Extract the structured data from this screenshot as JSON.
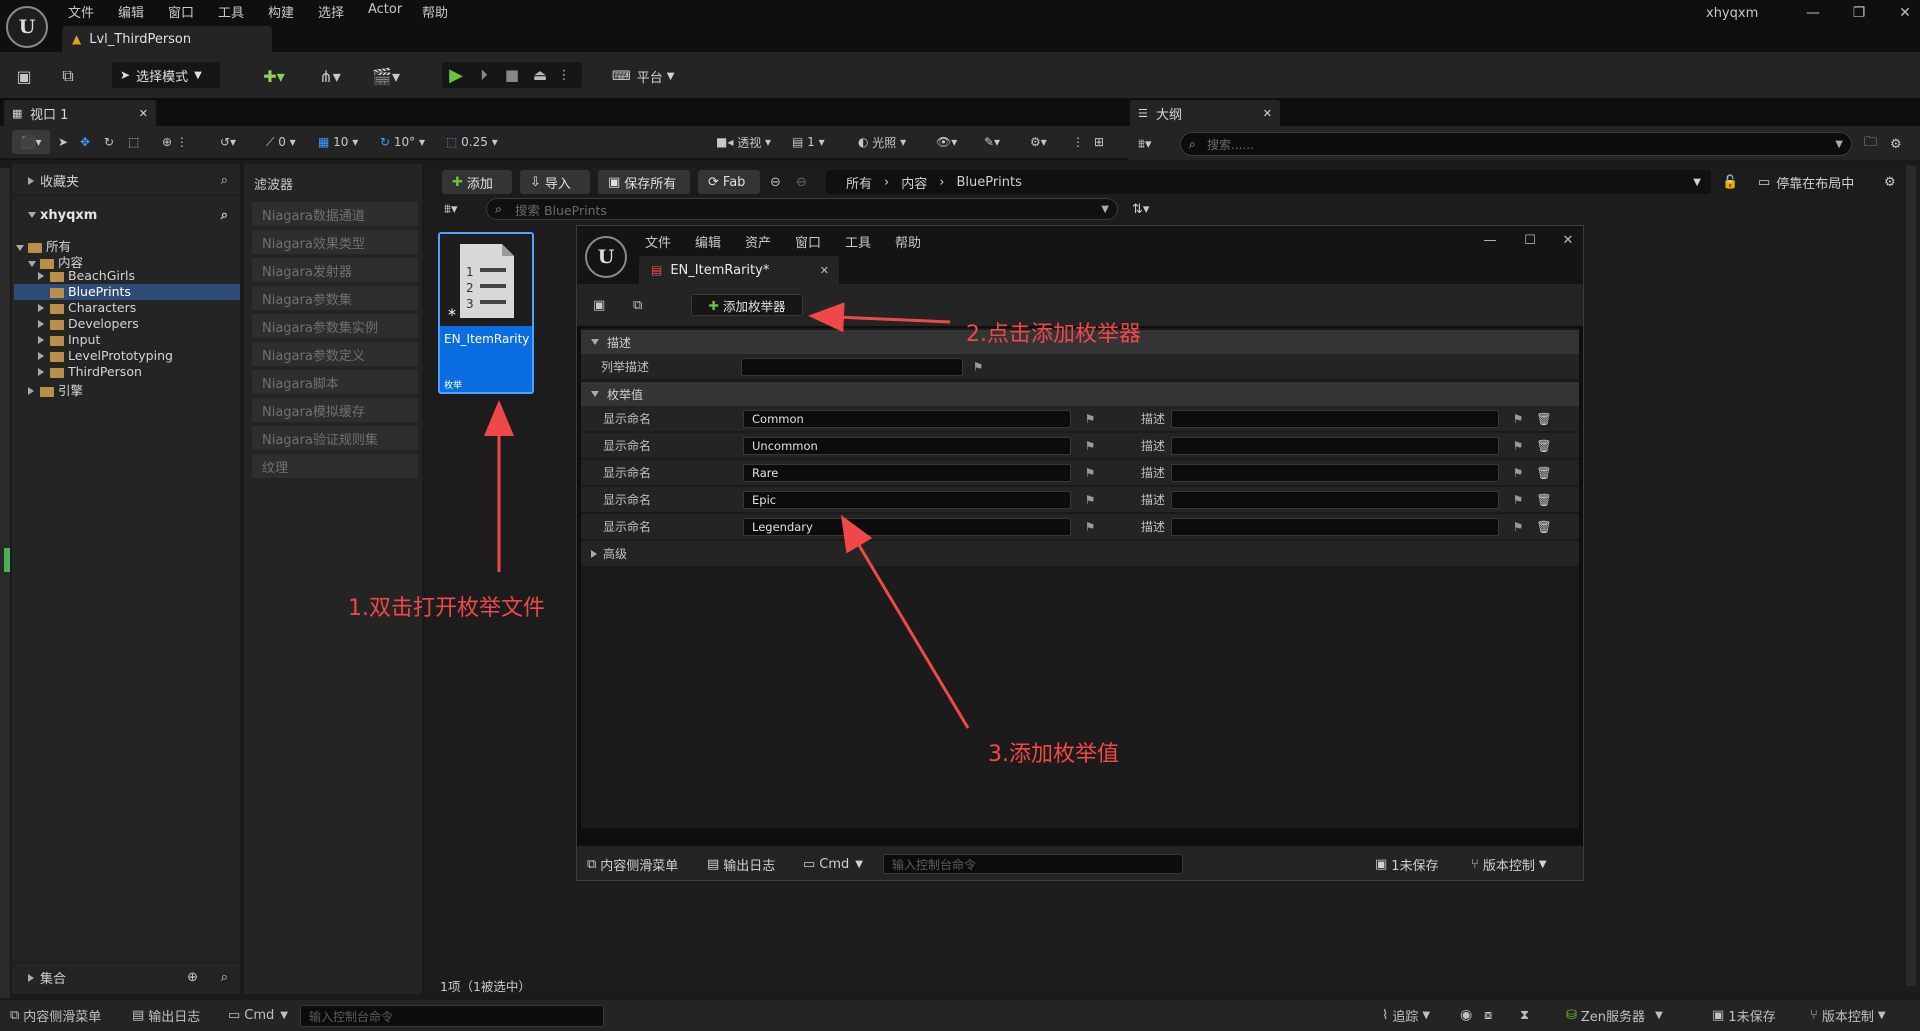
{
  "app": {
    "menu": [
      "文件",
      "编辑",
      "窗口",
      "工具",
      "构建",
      "选择",
      "Actor",
      "帮助"
    ],
    "level_tab": "Lvl_ThirdPerson",
    "user": "xhyqxm",
    "window_buttons": {
      "minimize": "—",
      "restore": "❐",
      "close": "✕"
    }
  },
  "toolbar": {
    "mode": "选择模式",
    "platform": "平台"
  },
  "viewport": {
    "tab": "视口 1",
    "perspective": "透视",
    "lighting": "光照",
    "snap_move": "10",
    "snap_rot": "10°",
    "snap_scale": "0.25",
    "angle": "0",
    "camera": "1"
  },
  "outliner": {
    "tab": "大纲",
    "search_placeholder": "搜索......"
  },
  "content_browser": {
    "favorites": "收藏夹",
    "root": "xhyqxm",
    "collections": "集合",
    "tree": [
      "所有",
      "内容",
      "BeachGirls",
      "BluePrints",
      "Characters",
      "Developers",
      "Input",
      "LevelPrototyping",
      "ThirdPerson",
      "引擎"
    ],
    "filters_title": "滤波器",
    "filters": [
      "Niagara数据通道",
      "Niagara效果类型",
      "Niagara发射器",
      "Niagara参数集",
      "Niagara参数集实例",
      "Niagara参数定义",
      "Niagara脚本",
      "Niagara模拟缓存",
      "Niagara验证规则集",
      "纹理"
    ],
    "buttons": {
      "add": "添加",
      "import": "导入",
      "save_all": "保存所有",
      "fab": "Fab"
    },
    "path": [
      "所有",
      "内容",
      "BluePrints"
    ],
    "dock_layout": "停靠在布局中",
    "search_placeholder": "搜索 BluePrints",
    "asset": {
      "name": "EN_ItemRarity",
      "type": "枚举"
    },
    "count": "1项（1被选中）"
  },
  "enum_editor": {
    "menu": [
      "文件",
      "编辑",
      "资产",
      "窗口",
      "工具",
      "帮助"
    ],
    "tab": "EN_ItemRarity*",
    "add_button": "添加枚举器",
    "section_desc": "描述",
    "enum_desc_label": "列举描述",
    "section_values": "枚举值",
    "display_label": "显示命名",
    "desc_label": "描述",
    "values": [
      "Common",
      "Uncommon",
      "Rare",
      "Epic",
      "Legendary"
    ],
    "advanced": "高级",
    "status": {
      "drawer": "内容侧滑菜单",
      "log": "输出日志",
      "cmd": "Cmd",
      "console_placeholder": "输入控制台命令",
      "unsaved": "1未保存",
      "version": "版本控制"
    }
  },
  "status": {
    "drawer": "内容侧滑菜单",
    "log": "输出日志",
    "cmd": "Cmd",
    "console_placeholder": "输入控制台命令",
    "trace": "追踪",
    "zen": "Zen服务器",
    "unsaved": "1未保存",
    "version": "版本控制"
  },
  "annotations": {
    "step1": "1.双击打开枚举文件",
    "step2": "2.点击添加枚举器",
    "step3": "3.添加枚举值"
  },
  "colors": {
    "accent": "#0a6de0",
    "annotation": "#f04848",
    "play": "#6cc03a"
  }
}
